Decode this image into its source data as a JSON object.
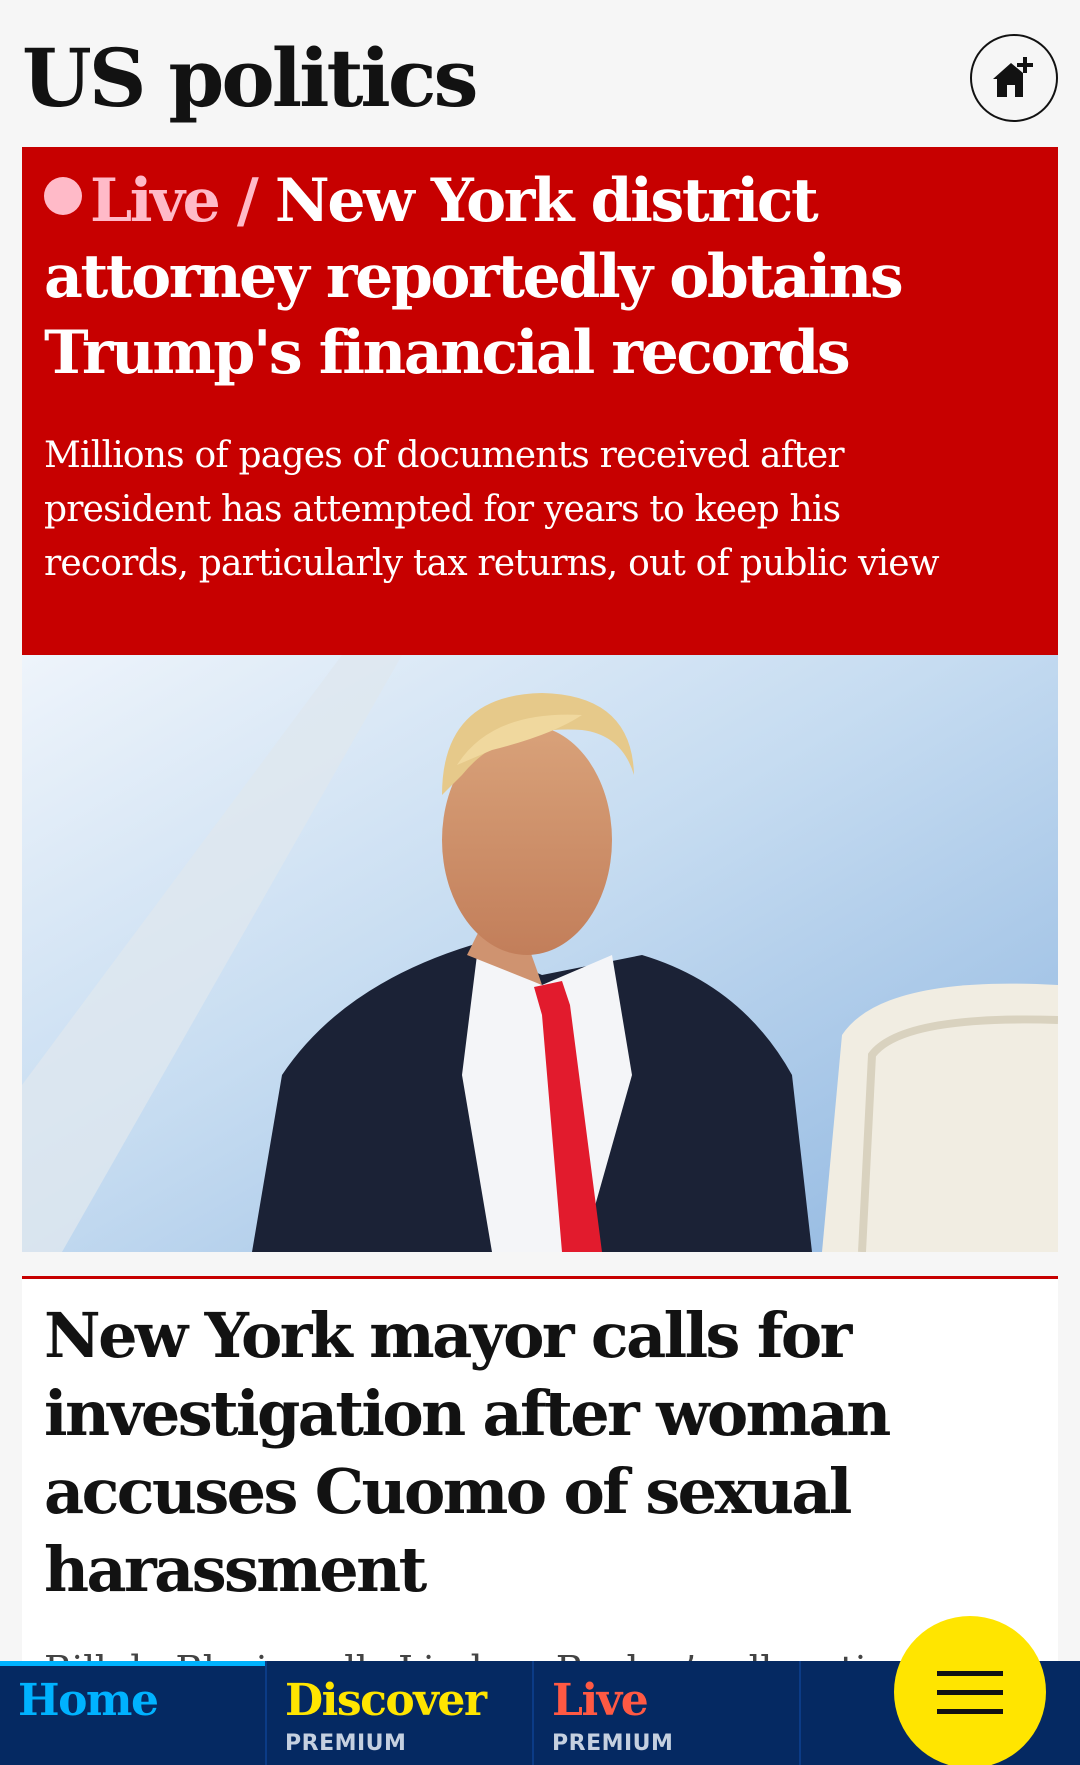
{
  "header": {
    "title": "US politics",
    "home_add_icon": "home-plus-icon"
  },
  "live_card": {
    "kicker": "Live /",
    "headline": "New York district attorney reportedly obtains Trump's financial records",
    "standfirst": "Millions of pages of documents received after president has attempted for years to keep his records, particularly tax returns, out of public view",
    "background_color": "#c70000",
    "kicker_color": "#ffbac8"
  },
  "hero_image": {
    "subject": "photo-man-in-suit-red-tie"
  },
  "second_card": {
    "headline": "New York mayor calls for investigation after woman accuses Cuomo of sexual harassment",
    "standfirst": "Bill de Blasio calls Lindsey Boylan’s allegations"
  },
  "bottom_nav": {
    "tabs": [
      {
        "label": "Home",
        "sub": "",
        "color": "#00b2ff"
      },
      {
        "label": "Discover",
        "sub": "PREMIUM",
        "color": "#ffe500"
      },
      {
        "label": "Live",
        "sub": "PREMIUM",
        "color": "#ff5943"
      }
    ],
    "menu_icon": "hamburger-menu-icon",
    "menu_color": "#ffe500"
  }
}
